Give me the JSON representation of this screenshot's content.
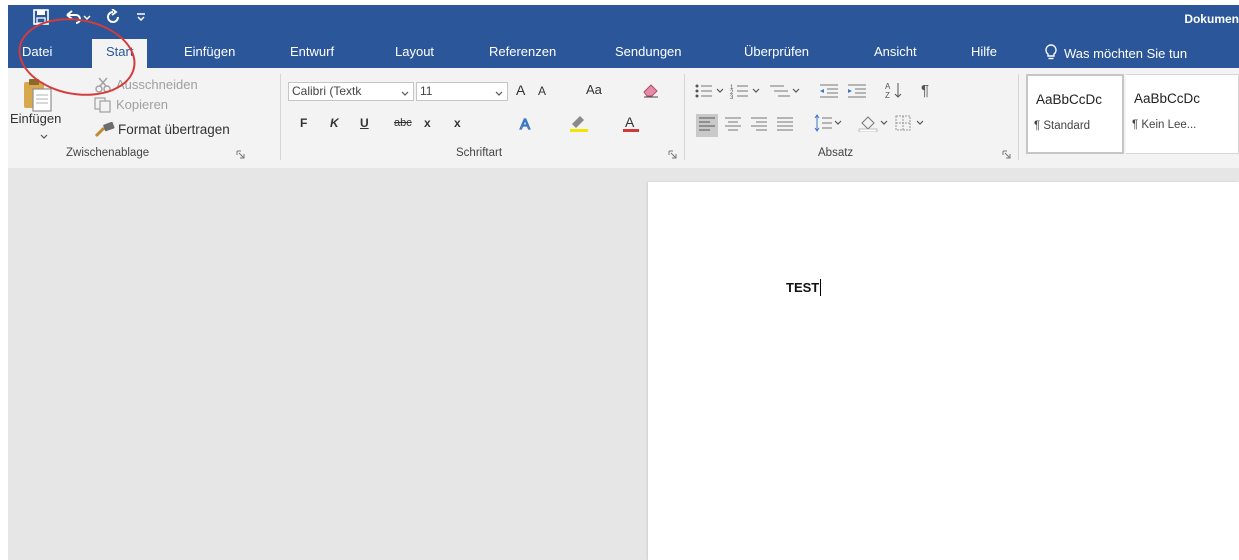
{
  "title_bar": {
    "document_title": "Dokumen"
  },
  "tabs": [
    "Datei",
    "Start",
    "Einfügen",
    "Entwurf",
    "Layout",
    "Referenzen",
    "Sendungen",
    "Überprüfen",
    "Ansicht",
    "Hilfe"
  ],
  "active_tab": "Start",
  "tell_me": "Was möchten Sie tun",
  "clipboard": {
    "paste": "Einfügen",
    "cut": "Ausschneiden",
    "copy": "Kopieren",
    "format_painter": "Format übertragen",
    "group_label": "Zwischenablage"
  },
  "font": {
    "font_name": "Calibri (Textk",
    "font_size": "11",
    "grow": "A",
    "shrink": "A",
    "change_case": "Aa",
    "bold": "F",
    "italic": "K",
    "underline": "U",
    "strikethrough": "abc",
    "subscript": "x",
    "superscript": "x",
    "font_color": "A",
    "group_label": "Schriftart"
  },
  "paragraph": {
    "group_label": "Absatz"
  },
  "styles": [
    {
      "sample": "AaBbCcDc",
      "name": "¶ Standard"
    },
    {
      "sample": "AaBbCcDc",
      "name": "¶ Kein Lee..."
    }
  ],
  "document": {
    "text": "TEST"
  },
  "colors": {
    "brand": "#2b579a",
    "ribbon": "#f3f3f3",
    "workspace": "#e6e6e6",
    "annotation": "#d63a3a"
  },
  "icons": [
    "save-icon",
    "undo-icon",
    "redo-icon",
    "qat-customize-icon",
    "lightbulb-icon",
    "paste-icon",
    "scissors-icon",
    "copy-icon",
    "format-painter-icon",
    "eraser-icon",
    "text-effects-icon",
    "highlighter-icon",
    "bullets-icon",
    "numbering-icon",
    "multilevel-list-icon",
    "decrease-indent-icon",
    "increase-indent-icon",
    "sort-icon",
    "pilcrow-icon",
    "align-left-icon",
    "align-center-icon",
    "align-right-icon",
    "justify-icon",
    "line-spacing-icon",
    "shading-icon",
    "borders-icon",
    "dialog-launcher-icon"
  ]
}
